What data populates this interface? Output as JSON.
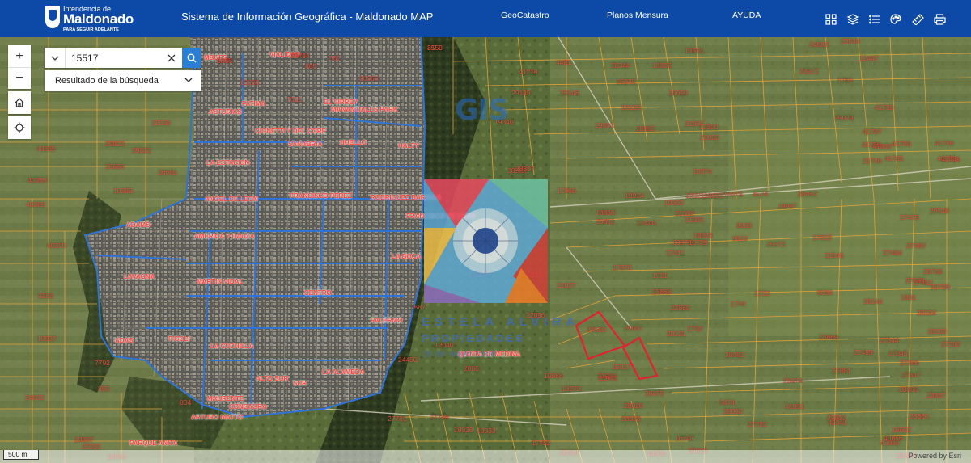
{
  "header": {
    "logo_top": "Intendencia de",
    "logo_main": "Maldonado",
    "logo_sub": "PARA SEGUIR ADELANTE",
    "title": "Sistema de Información Geográfica - Maldonado MAP",
    "links": [
      "GeoCatastro",
      "Planos Mensura",
      "AYUDA"
    ],
    "tools": [
      "grid-icon",
      "layers-icon",
      "list-icon",
      "palette-icon",
      "measure-icon",
      "print-icon"
    ]
  },
  "search": {
    "value": "15517",
    "results_label": "Resultado de la búsqueda"
  },
  "map_controls": {
    "zoom_in": "+",
    "zoom_out": "−"
  },
  "scalebar": "500 m",
  "attribution": "Powered by Esri",
  "watermarks": {
    "gis": "GIS",
    "agency_line1": "ESTELA ALVIRA",
    "agency_line2": "PROPIEDADES",
    "agency_line3": "18 de mayo 1000"
  },
  "neighborhoods": [
    "MBUES",
    "VIALIDAD",
    "ASTURIAS",
    "FATIMA",
    "EL VIRREY",
    "MANANTIALES PARK",
    "CIGNETTI Y DEL CORE",
    "SANABRIA",
    "HUELLO",
    "HALTY",
    "LA ESTACION",
    "ANGEL DE LEON",
    "FRANCISCO PEREZ",
    "RODRIGUEZ BARRIOS",
    "FRANCISCO DE LEON",
    "ADAMS",
    "AMERICA Y DAUZA",
    "LA BOCA",
    "LAVAGNA",
    "MARTIN VIDAL",
    "CENTRO",
    "PALERMO",
    "ADAS",
    "FIGOLI",
    "LA CUCHILLA",
    "QUINTA DE MEDINA",
    "ALTO SUR",
    "SUR",
    "LA ALAMEDA",
    "MAURENTE",
    "CONSAGRA",
    "ARTURO MATTO",
    "PARQUE ANITA"
  ],
  "parcels": [
    "5148",
    "8150",
    "2043",
    "562",
    "805",
    "13260",
    "7611",
    "30365",
    "24633",
    "23543",
    "12447",
    "25972",
    "1750",
    "4481",
    "26344",
    "13302",
    "13551",
    "41218",
    "29149",
    "29148",
    "26345",
    "20129",
    "26059",
    "19340",
    "19341",
    "18862",
    "21066",
    "21067",
    "13300",
    "41780",
    "25979",
    "41787",
    "41790",
    "41806",
    "41789",
    "41786",
    "41788",
    "41783",
    "41785",
    "21746",
    "22530",
    "29823",
    "29822",
    "40365",
    "26666",
    "26665",
    "40368",
    "16399",
    "40369",
    "40370",
    "9263",
    "19937",
    "7792",
    "853",
    "24032",
    "834",
    "29807",
    "22331",
    "18068",
    "17966",
    "19914",
    "21027",
    "25857",
    "22440",
    "20979",
    "21005",
    "18933",
    "19302",
    "21302",
    "25861",
    "19374",
    "18860",
    "15728",
    "17411",
    "17970",
    "18659",
    "28062",
    "18879",
    "4574",
    "19921",
    "18997",
    "8868",
    "9610",
    "17919",
    "21545",
    "25372",
    "27479",
    "20548",
    "27480",
    "27484",
    "27483",
    "27482",
    "28768",
    "20798",
    "28144",
    "28154",
    "28230",
    "27280",
    "27344",
    "27345",
    "27346",
    "27347",
    "23866",
    "23867",
    "23868",
    "23865",
    "1730",
    "1731",
    "1744",
    "1723",
    "8094",
    "20131",
    "23869",
    "27489",
    "26452",
    "21861",
    "26474",
    "26475",
    "28026",
    "28028",
    "29952",
    "19568",
    "21904",
    "24560",
    "21903",
    "15517",
    "13270",
    "12040",
    "2000",
    "22089",
    "2587",
    "22096",
    "24450",
    "27781",
    "27799",
    "19326",
    "10333",
    "17452",
    "28026",
    "18006",
    "16747",
    "28029",
    "28030",
    "27782",
    "5474",
    "41061",
    "42041",
    "43958",
    "19652",
    "40856",
    "28303",
    "28360",
    "28362",
    "28307",
    "25440",
    "1800",
    "1801",
    "2658",
    "2559",
    "27484"
  ]
}
